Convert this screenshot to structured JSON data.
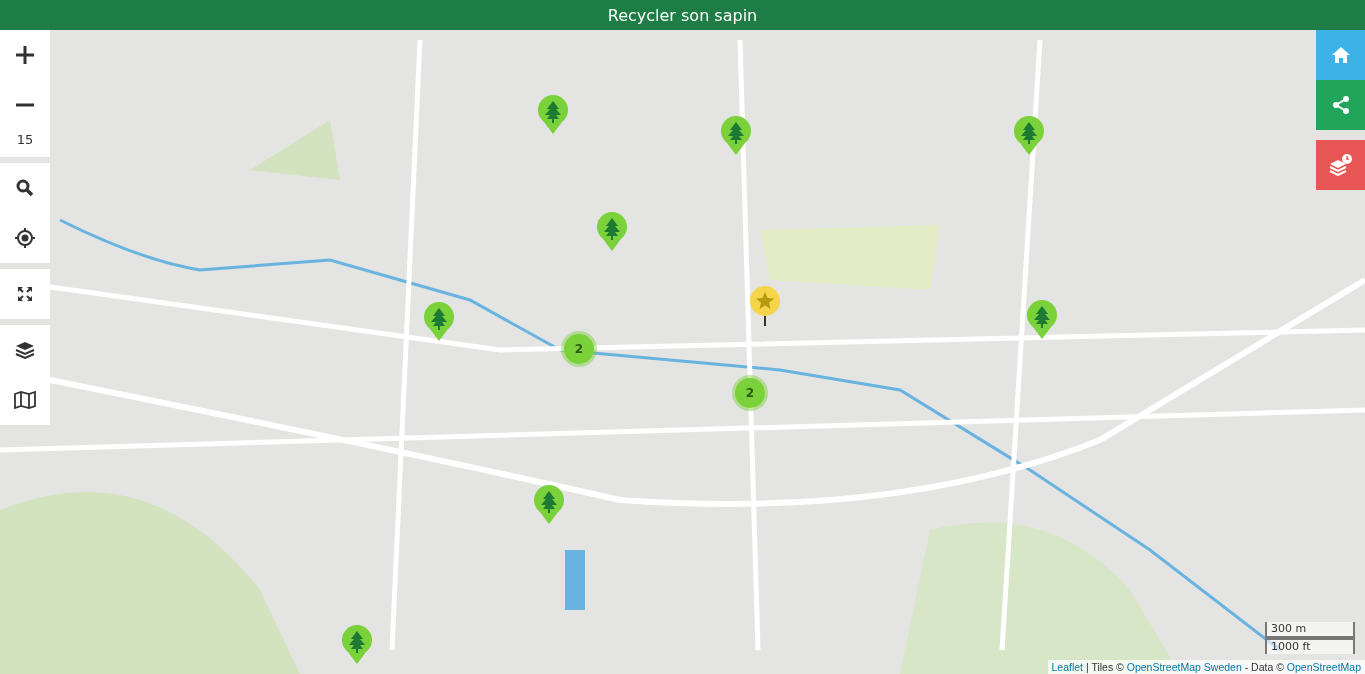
{
  "header": {
    "title": "Recycler son sapin"
  },
  "zoom": {
    "level_text": "15"
  },
  "markers": [
    {
      "kind": "tree"
    },
    {
      "kind": "tree"
    },
    {
      "kind": "tree"
    },
    {
      "kind": "tree"
    },
    {
      "kind": "tree"
    },
    {
      "kind": "tree"
    },
    {
      "kind": "tree"
    },
    {
      "kind": "tree"
    },
    {
      "kind": "cluster",
      "count": "2"
    },
    {
      "kind": "cluster",
      "count": "2"
    },
    {
      "kind": "star"
    }
  ],
  "scale": {
    "metric": "300 m",
    "imperial": "1000 ft"
  },
  "attribution": [
    {
      "kind": "link",
      "text": "Leaflet"
    },
    {
      "kind": "text",
      "text": " | Tiles © "
    },
    {
      "kind": "link",
      "text": "OpenStreetMap Sweden"
    },
    {
      "kind": "text",
      "text": " - Data © "
    },
    {
      "kind": "link",
      "text": "OpenStreetMap"
    }
  ]
}
